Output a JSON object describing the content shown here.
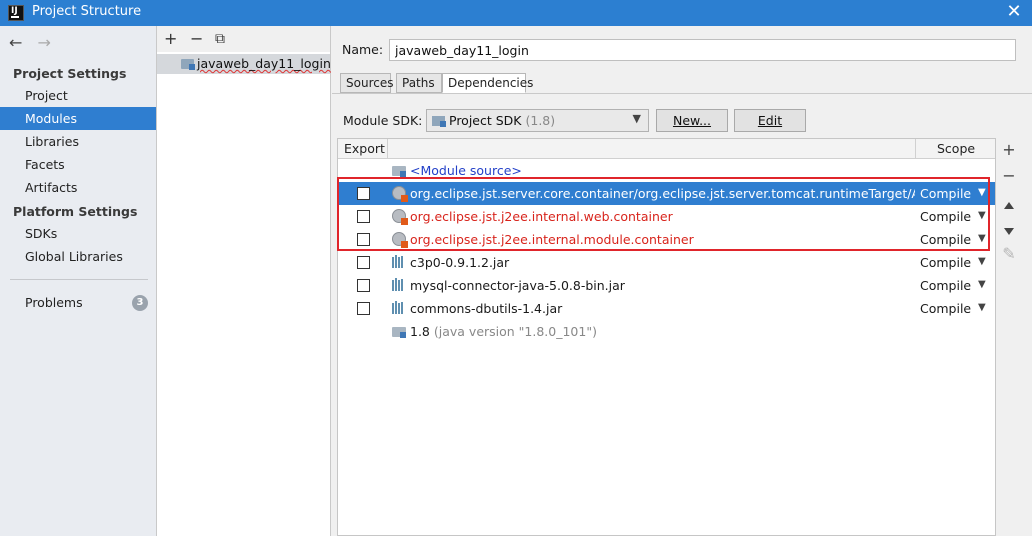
{
  "window": {
    "title": "Project Structure",
    "close_glyph": "✕"
  },
  "nav": {
    "back": "←",
    "forward": "→",
    "project_settings_title": "Project Settings",
    "project_settings": [
      "Project",
      "Modules",
      "Libraries",
      "Facets",
      "Artifacts"
    ],
    "platform_settings_title": "Platform Settings",
    "platform_settings": [
      "SDKs",
      "Global Libraries"
    ],
    "problems_label": "Problems",
    "problems_count": "3",
    "selected": "Modules"
  },
  "modules": {
    "toolbar": {
      "add": "+",
      "remove": "−",
      "copy": "⧉"
    },
    "items": [
      "javaweb_day11_login"
    ]
  },
  "module_detail": {
    "name_label": "Name:",
    "name_value": "javaweb_day11_login",
    "tabs": [
      "Sources",
      "Paths",
      "Dependencies"
    ],
    "active_tab": "Dependencies",
    "sdk_label": "Module SDK:",
    "sdk_value": "Project SDK",
    "sdk_version": "(1.8)",
    "new_button": "New...",
    "edit_button": "Edit"
  },
  "dependencies": {
    "columns": {
      "export": "Export",
      "scope": "Scope"
    },
    "rows": [
      {
        "name": "<Module source>",
        "scope": "",
        "icon": "folder-icon",
        "checkbox": false
      },
      {
        "name": "org.eclipse.jst.server.core.container/org.eclipse.jst.server.tomcat.runtimeTarget/Apache",
        "scope": "Compile",
        "icon": "globe-library-icon",
        "checkbox": true
      },
      {
        "name": "org.eclipse.jst.j2ee.internal.web.container",
        "scope": "Compile",
        "icon": "globe-library-icon",
        "checkbox": true
      },
      {
        "name": "org.eclipse.jst.j2ee.internal.module.container",
        "scope": "Compile",
        "icon": "globe-library-icon",
        "checkbox": true
      },
      {
        "name": "c3p0-0.9.1.2.jar",
        "scope": "Compile",
        "icon": "jar-icon",
        "checkbox": true
      },
      {
        "name": "mysql-connector-java-5.0.8-bin.jar",
        "scope": "Compile",
        "icon": "jar-icon",
        "checkbox": true
      },
      {
        "name": "commons-dbutils-1.4.jar",
        "scope": "Compile",
        "icon": "jar-icon",
        "checkbox": true
      },
      {
        "name": "1.8",
        "name_suffix": "(java version \"1.8.0_101\")",
        "scope": "",
        "icon": "sdk-folder-icon",
        "checkbox": false
      }
    ],
    "side_buttons": {
      "add": "+",
      "remove": "−",
      "up": "up",
      "down": "down",
      "edit": "✎"
    }
  },
  "colors": {
    "titlebar": "#2c7fd1",
    "selection": "#2f7ed0",
    "error_text": "#d8241c",
    "module_source_text": "#2340c8",
    "highlight_box": "#e0252b"
  }
}
